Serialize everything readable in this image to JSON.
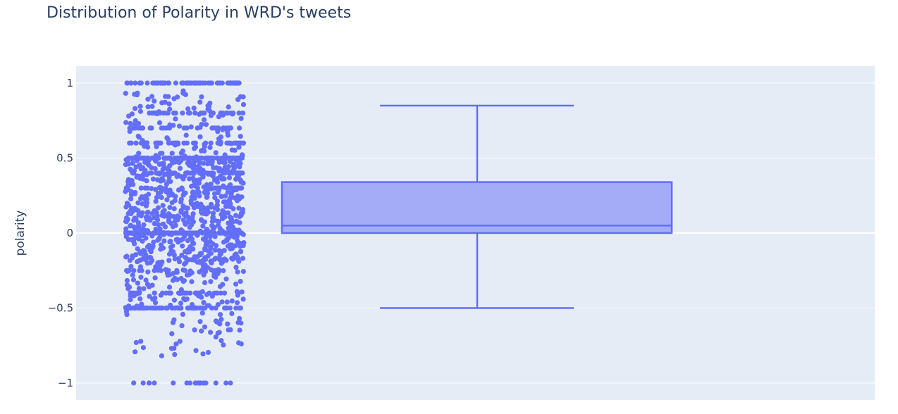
{
  "chart_data": {
    "type": "box",
    "title": "Distribution of Polarity in WRD's tweets",
    "ylabel": "polarity",
    "xlabel": "",
    "ylim": [
      -1.1,
      1.1
    ],
    "yticks": [
      1,
      0.5,
      0,
      -0.5,
      -1
    ],
    "ytick_labels": [
      "1",
      "0.5",
      "0",
      "−0.5",
      "−1"
    ],
    "grid": true,
    "boxpoints": "all",
    "box": {
      "lower_fence": -0.5,
      "q1": 0,
      "median": 0.05,
      "q3": 0.34,
      "upper_fence": 0.85
    },
    "colors": {
      "marker": "#636efa",
      "box_fill": "#a4acf7",
      "plot_bg": "#e5ecf6",
      "grid": "#ffffff",
      "text": "#2a3f5f"
    }
  }
}
